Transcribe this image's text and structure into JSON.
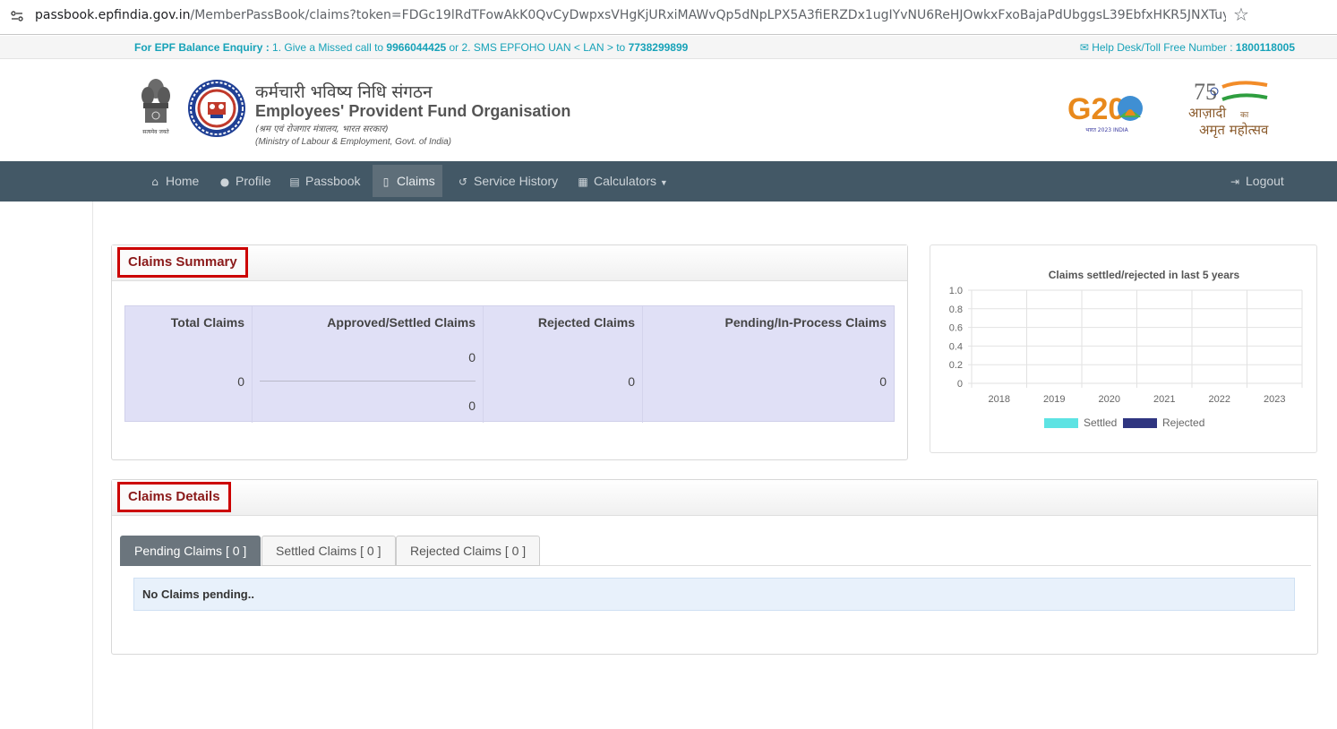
{
  "browser": {
    "url_host": "passbook.epfindia.gov.in",
    "url_path": "/MemberPassBook/claims?token=FDGc19lRdTFowAkK0QvCyDwpxsVHgKjURxiMAWvQp5dNpLPX5A3fiERZDx1ugIYvNU6ReHJOwkxFxoBajaPdUbggsL39EbfxHKR5JNXTuygldtqjAwMxm..."
  },
  "infostrip": {
    "enquiry_label": "For EPF Balance Enquiry :",
    "enquiry_text_1": " 1. Give a Missed call to ",
    "missed_call_number": "9966044425",
    "enquiry_text_2": " or 2. SMS EPFOHO UAN < LAN > to ",
    "sms_number": "7738299899",
    "helpdesk_label": "Help Desk/Toll Free Number : ",
    "helpdesk_number": "1800118005"
  },
  "header": {
    "emblem_caption": "सत्यमेव जयते",
    "org_name_hindi": "कर्मचारी भविष्य निधि संगठन",
    "org_name_english": "Employees' Provident Fund Organisation",
    "ministry_hindi": "(श्रम एवं रोजगार मंत्रालय, भारत सरकार)",
    "ministry_english": "(Ministry of Labour & Employment, Govt. of India)",
    "g20_logo_text": "G20",
    "g20_caption": "भारत 2023 INDIA",
    "azadi_line1": "आज़ादी",
    "azadi_ka": "का",
    "azadi_line2": "अमृत महोत्सव"
  },
  "nav": {
    "items": [
      {
        "label": "Home",
        "icon": "home-icon"
      },
      {
        "label": "Profile",
        "icon": "user-icon"
      },
      {
        "label": "Passbook",
        "icon": "passbook-icon"
      },
      {
        "label": "Claims",
        "icon": "document-icon"
      },
      {
        "label": "Service History",
        "icon": "history-icon"
      },
      {
        "label": "Calculators",
        "icon": "calculator-icon"
      }
    ],
    "logout_label": "Logout",
    "active": "Claims"
  },
  "summary": {
    "title": "Claims Summary",
    "headers": [
      "Total Claims",
      "Approved/Settled Claims",
      "Rejected Claims",
      "Pending/In-Process Claims"
    ],
    "total": "0",
    "approved_top": "0",
    "approved_bottom": "0",
    "rejected": "0",
    "pending": "0"
  },
  "chart_data": {
    "type": "bar",
    "title": "Claims settled/rejected in last 5 years",
    "categories": [
      "2018",
      "2019",
      "2020",
      "2021",
      "2022",
      "2023"
    ],
    "series": [
      {
        "name": "Settled",
        "values": [
          0,
          0,
          0,
          0,
          0,
          0
        ],
        "color": "#5de3e3"
      },
      {
        "name": "Rejected",
        "values": [
          0,
          0,
          0,
          0,
          0,
          0
        ],
        "color": "#2f3580"
      }
    ],
    "yticks": [
      "0",
      "0.2",
      "0.4",
      "0.6",
      "0.8",
      "1.0"
    ],
    "ylim": [
      0,
      1.0
    ],
    "grid": true,
    "legend": "bottom"
  },
  "details": {
    "title": "Claims Details",
    "tabs": [
      "Pending Claims [ 0 ]",
      "Settled Claims [ 0 ]",
      "Rejected Claims [ 0 ]"
    ],
    "active_tab": "Pending Claims [ 0 ]",
    "message": "No Claims pending.."
  }
}
